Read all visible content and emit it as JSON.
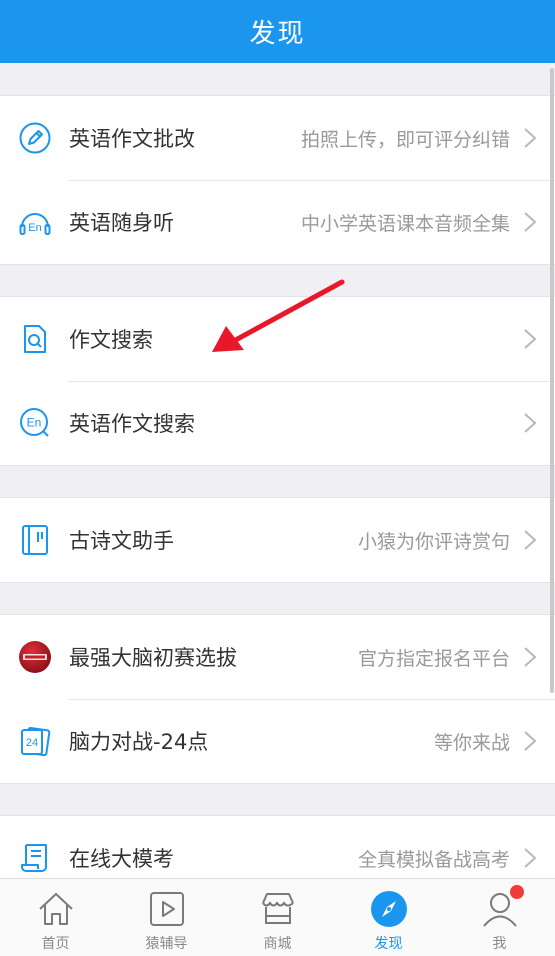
{
  "header": {
    "title": "发现"
  },
  "groups": [
    {
      "items": [
        {
          "title": "英语作文批改",
          "subtitle": "拍照上传，即可评分纠错",
          "icon": "pencil-circle-icon"
        },
        {
          "title": "英语随身听",
          "subtitle": "中小学英语课本音频全集",
          "icon": "headphones-en-icon"
        }
      ]
    },
    {
      "items": [
        {
          "title": "作文搜索",
          "subtitle": "",
          "icon": "document-search-icon"
        },
        {
          "title": "英语作文搜索",
          "subtitle": "",
          "icon": "en-search-icon"
        }
      ]
    },
    {
      "items": [
        {
          "title": "古诗文助手",
          "subtitle": "小猿为你评诗赏句",
          "icon": "book-icon"
        }
      ]
    },
    {
      "items": [
        {
          "title": "最强大脑初赛选拔",
          "subtitle": "官方指定报名平台",
          "icon": "strongest-brain-logo-icon"
        },
        {
          "title": "脑力对战-24点",
          "subtitle": "等你来战",
          "icon": "card-24-icon"
        }
      ]
    },
    {
      "items": [
        {
          "title": "在线大模考",
          "subtitle": "全真模拟备战高考",
          "icon": "scroll-exam-icon"
        }
      ]
    }
  ],
  "tabs": [
    {
      "label": "首页",
      "icon": "home-icon"
    },
    {
      "label": "猿辅导",
      "icon": "play-icon"
    },
    {
      "label": "商城",
      "icon": "shop-icon"
    },
    {
      "label": "发现",
      "icon": "compass-icon"
    },
    {
      "label": "我",
      "icon": "user-icon"
    }
  ],
  "colors": {
    "primary": "#1a96ee",
    "badge": "#f23c3c",
    "arrow": "#e8182a"
  }
}
